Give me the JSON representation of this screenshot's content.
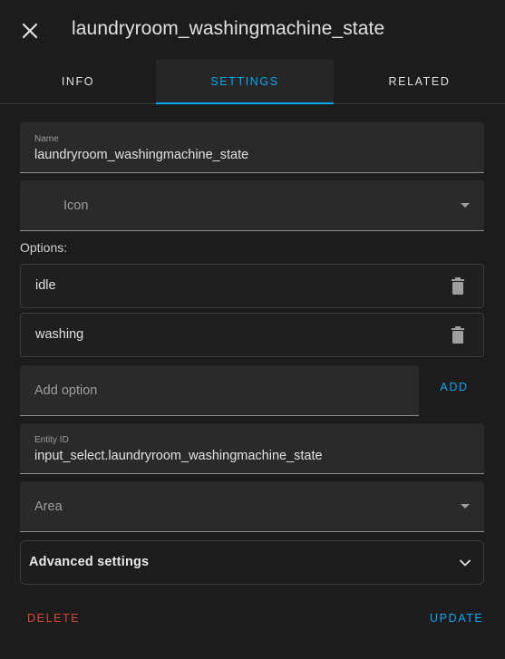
{
  "header": {
    "title": "laundryroom_washingmachine_state",
    "close_icon": "close-icon"
  },
  "tabs": [
    {
      "label": "INFO",
      "active": false
    },
    {
      "label": "SETTINGS",
      "active": true
    },
    {
      "label": "RELATED",
      "active": false
    }
  ],
  "form": {
    "name": {
      "label": "Name",
      "value": "laundryroom_washingmachine_state"
    },
    "icon": {
      "placeholder": "Icon"
    },
    "options_label": "Options:",
    "options": [
      {
        "value": "idle",
        "delete_icon": "trash-icon"
      },
      {
        "value": "washing",
        "delete_icon": "trash-icon"
      }
    ],
    "add_option": {
      "placeholder": "Add option",
      "button_label": "ADD"
    },
    "entity_id": {
      "label": "Entity ID",
      "value": "input_select.laundryroom_washingmachine_state"
    },
    "area": {
      "placeholder": "Area"
    },
    "advanced": {
      "label": "Advanced settings"
    }
  },
  "footer": {
    "delete_label": "DELETE",
    "update_label": "UPDATE"
  },
  "colors": {
    "accent": "#03a9f4",
    "danger": "#db4437",
    "background": "#1c1c1c",
    "field_background": "#2a2a2a"
  }
}
